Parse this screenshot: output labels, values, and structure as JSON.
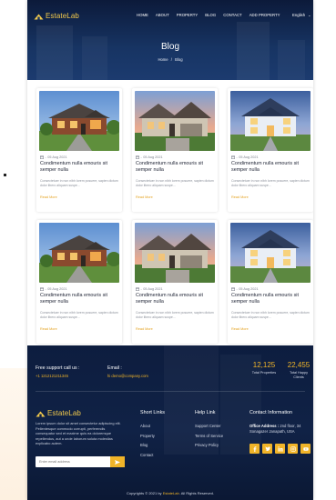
{
  "header": {
    "logo_text": "EstateLab",
    "nav": [
      "HOME",
      "ABOUT",
      "PROPERTY",
      "BLOG",
      "CONTACT",
      "ADD PROPERTY"
    ],
    "language": "English",
    "title": "Blog",
    "breadcrumb": {
      "home": "Home",
      "sep": "/",
      "current": "Blog"
    }
  },
  "posts": [
    {
      "date": "05 Aug 2021",
      "title": "Condimentum nulla emouris sit semper nulla",
      "excerpt": "Consectetuer in non nibh lorem posuere, sapien dictum dolor libero aliquam suspe...",
      "link": "Read More",
      "image": "house-brick"
    },
    {
      "date": "05 Aug 2021",
      "title": "Condimentum nulla emouris sit semper nulla",
      "excerpt": "Consectetuer in non nibh lorem posuere, sapien dictum dolor libero aliquam suspe...",
      "link": "Read More",
      "image": "house-sunset"
    },
    {
      "date": "05 Aug 2021",
      "title": "Condimentum nulla emouris sit semper nulla",
      "excerpt": "Consectetuer in non nibh lorem posuere, sapien dictum dolor libero aliquam suspe...",
      "link": "Read More",
      "image": "house-blue"
    },
    {
      "date": "05 Aug 2021",
      "title": "Condimentum nulla emouris sit semper nulla",
      "excerpt": "Consectetuer in non nibh lorem posuere, sapien dictum dolor libero aliquam suspe...",
      "link": "Read More",
      "image": "house-brick"
    },
    {
      "date": "05 Aug 2021",
      "title": "Condimentum nulla emouris sit semper nulla",
      "excerpt": "Consectetuer in non nibh lorem posuere, sapien dictum dolor libero aliquam suspe...",
      "link": "Read More",
      "image": "house-sunset"
    },
    {
      "date": "05 Aug 2021",
      "title": "Condimentum nulla emouris sit semper nulla",
      "excerpt": "Consectetuer in non nibh lorem posuere, sapien dictum dolor libero aliquam suspe...",
      "link": "Read More",
      "image": "house-blue"
    }
  ],
  "footer": {
    "support_label": "Free support call us :",
    "support_phone": "+1 1212121211345",
    "email_label": "Email :",
    "email_value": "hi demo@company.com",
    "stats": [
      {
        "value": "12,125",
        "label": "Total Properties"
      },
      {
        "value": "22,455",
        "label": "Total Happy Clients"
      }
    ],
    "logo_text": "EstateLab",
    "description": "Lorem ipsum dolor sit amet consectetur adipiscing elit. Pellentesque commodo corrupti, perferendis consequatur sed et maxime quis ea doloremque repellendus, aut a unde laborum soluta molestias explicabo autem.",
    "subscribe_placeholder": "Enter email address",
    "short_links": {
      "heading": "Short Links",
      "items": [
        "About",
        "Property",
        "Blog",
        "Contact"
      ]
    },
    "help_link": {
      "heading": "Help Link",
      "items": [
        "Support Center",
        "Terms of Service",
        "Privacy Policy"
      ]
    },
    "contact": {
      "heading": "Contact Information",
      "address_label": "Office Address :",
      "address": "2nd floor, 34 Sonagazer Janapath, USA"
    },
    "socials": [
      "facebook-icon",
      "twitter-icon",
      "linkedin-icon",
      "instagram-icon",
      "youtube-icon"
    ],
    "copyright_prefix": "Copyrights © 2021 by",
    "copyright_brand": "EstateLab",
    "copyright_suffix": ". All Rights Reserved."
  },
  "colors": {
    "accent": "#f0b429",
    "navy": "#102246",
    "logo": "#f2c94c"
  }
}
